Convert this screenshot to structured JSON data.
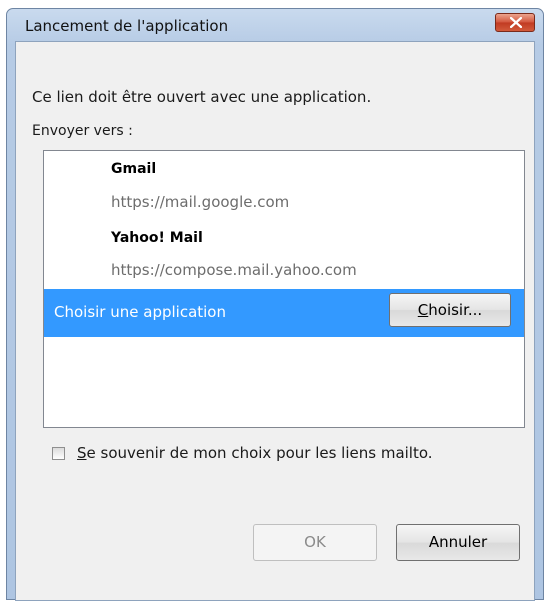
{
  "window": {
    "title": "Lancement de l'application",
    "close_icon": "close-icon"
  },
  "dialog": {
    "message": "Ce lien doit être ouvert avec une application.",
    "send_to_label": "Envoyer vers :"
  },
  "apps": [
    {
      "name": "Gmail",
      "url": "https://mail.google.com"
    },
    {
      "name": "Yahoo! Mail",
      "url": "https://compose.mail.yahoo.com"
    }
  ],
  "choose_app": {
    "label": "Choisir une application",
    "button_mnemonic": "C",
    "button_rest": "hoisir..."
  },
  "remember": {
    "mnemonic": "S",
    "rest": "e souvenir de mon choix pour les liens mailto.",
    "checked": false
  },
  "buttons": {
    "ok": "OK",
    "cancel": "Annuler"
  },
  "colors": {
    "selection": "#3399ff",
    "titlebar": "#b9cde5",
    "close_button": "#c9452c"
  }
}
